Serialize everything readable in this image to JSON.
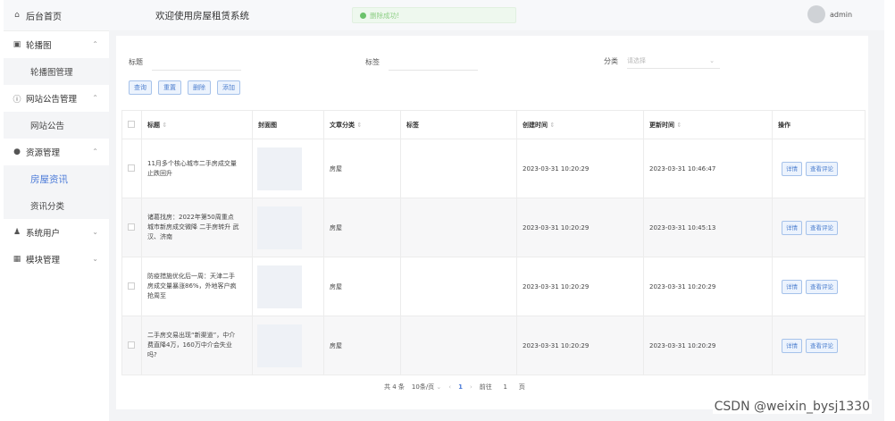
{
  "sidebar": {
    "home": "后台首页",
    "groups": [
      {
        "label": "轮播图",
        "icon": "image-icon",
        "children": [
          "轮播图管理"
        ]
      },
      {
        "label": "网站公告管理",
        "icon": "info-icon",
        "children": [
          "网站公告"
        ]
      },
      {
        "label": "资源管理",
        "icon": "pin-icon",
        "children": [
          "房屋资讯",
          "资讯分类"
        ]
      },
      {
        "label": "系统用户",
        "icon": "user-icon",
        "children": []
      },
      {
        "label": "模块管理",
        "icon": "grid-icon",
        "children": []
      }
    ],
    "active_item": "房屋资讯"
  },
  "header": {
    "title": "欢迎使用房屋租赁系统",
    "toast": "删除成功!",
    "user": "admin"
  },
  "search": {
    "title_label": "标题",
    "tag_label": "标签",
    "category_label": "分类",
    "category_placeholder": "请选择"
  },
  "buttons": {
    "query": "查询",
    "reset": "重置",
    "delete": "删除",
    "add": "添加"
  },
  "table": {
    "columns": [
      "标题",
      "封面图",
      "文章分类",
      "标签",
      "创建时间",
      "更新时间",
      "操作"
    ],
    "rows": [
      {
        "title": "11月多个核心城市二手房成交量止跌回升",
        "category": "房屋",
        "tag": "",
        "created": "2023-03-31 10:20:29",
        "updated": "2023-03-31 10:46:47"
      },
      {
        "title": "诸葛找房：2022年第50周重点城市新房成交微降 二手房转升 武汉、济南",
        "category": "房屋",
        "tag": "",
        "created": "2023-03-31 10:20:29",
        "updated": "2023-03-31 10:45:13"
      },
      {
        "title": "防疫措施优化后一周：天津二手房成交量暴涨86%，外地客户疯抢周至",
        "category": "房屋",
        "tag": "",
        "created": "2023-03-31 10:20:29",
        "updated": "2023-03-31 10:20:29"
      },
      {
        "title": "二手房交易出现“新渠道”，中介费直降4万，160万中介会失业吗?",
        "category": "房屋",
        "tag": "",
        "created": "2023-03-31 10:20:29",
        "updated": "2023-03-31 10:20:29"
      }
    ],
    "row_actions": [
      "详情",
      "查看评论"
    ]
  },
  "pagination": {
    "total": "共 4 条",
    "page_size": "10条/页",
    "current": "1",
    "goto_label": "前往",
    "goto_value": "1",
    "page_suffix": "页"
  },
  "watermark": "CSDN @weixin_bysj1330",
  "colors": {
    "accent": "#4a7ad8",
    "toast_bg": "#eef8ee",
    "button_bg": "#ecf3fd"
  }
}
